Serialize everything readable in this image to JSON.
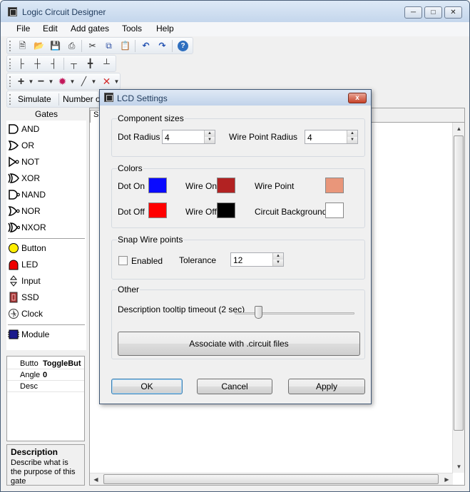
{
  "window": {
    "title": "Logic Circuit Designer"
  },
  "menu": [
    "File",
    "Edit",
    "Add gates",
    "Tools",
    "Help"
  ],
  "toolbar3": {
    "simulate": "Simulate",
    "number_label": "Number o"
  },
  "gates_panel": {
    "header": "Gates",
    "gates": [
      "AND",
      "OR",
      "NOT",
      "XOR",
      "NAND",
      "NOR",
      "NXOR"
    ],
    "io": [
      "Button",
      "LED",
      "Input",
      "SSD",
      "Clock"
    ],
    "module": "Module"
  },
  "properties": [
    {
      "key": "Butto",
      "value": "ToggleBut"
    },
    {
      "key": "Angle",
      "value": "0"
    },
    {
      "key": "Desc",
      "value": ""
    }
  ],
  "description": {
    "title": "Description",
    "text": "Describe what is the purpose of this gate"
  },
  "canvas": {
    "tab": "S"
  },
  "dialog": {
    "title": "LCD Settings",
    "close": "x",
    "component_sizes": {
      "title": "Component sizes",
      "dot_radius_label": "Dot Radius",
      "dot_radius_value": "4",
      "wire_point_radius_label": "Wire Point Radius",
      "wire_point_radius_value": "4"
    },
    "colors": {
      "title": "Colors",
      "dot_on": "Dot On",
      "wire_on": "Wire On",
      "wire_point": "Wire Point",
      "dot_off": "Dot Off",
      "wire_off": "Wire Off",
      "circuit_background": "Circuit Background",
      "swatches": {
        "dot_on": "#0a0aff",
        "wire_on": "#b22222",
        "wire_point": "#e9967a",
        "dot_off": "#ff0000",
        "wire_off": "#000000",
        "circuit_background": "#ffffff"
      }
    },
    "snap": {
      "title": "Snap Wire points",
      "enabled_label": "Enabled",
      "enabled": false,
      "tolerance_label": "Tolerance",
      "tolerance_value": "12"
    },
    "other": {
      "title": "Other",
      "tooltip_label": "Description tooltip timeout (2 sec)",
      "tooltip_level": 0.2,
      "associate_button": "Associate with .circuit files"
    },
    "buttons": {
      "ok": "OK",
      "cancel": "Cancel",
      "apply": "Apply"
    }
  }
}
